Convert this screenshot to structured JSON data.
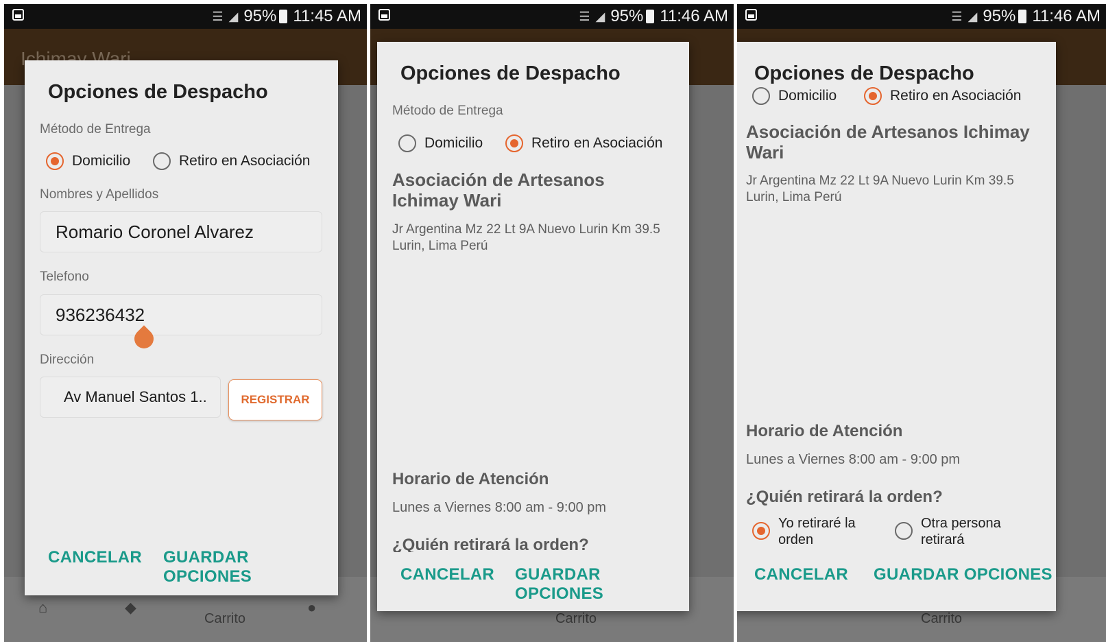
{
  "screens": [
    {
      "status": {
        "battery": "95%",
        "time": "11:45 AM"
      },
      "app_title": "Ichimay Wari",
      "dialog": {
        "title": "Opciones de Despacho",
        "method_label": "Método de Entrega",
        "options": [
          "Domicilio",
          "Retiro en Asociación"
        ],
        "selected": "Domicilio",
        "name_label": "Nombres y Apellidos",
        "name_value": "Romario Coronel Alvarez",
        "phone_label": "Telefono",
        "phone_value": "936236432",
        "address_label": "Dirección",
        "address_value": "Av Manuel Santos 1..",
        "register_button": "REGISTRAR",
        "cancel": "CANCELAR",
        "save": "GUARDAR OPCIONES"
      },
      "bottom_nav": {
        "cart_label": "Carrito"
      }
    },
    {
      "status": {
        "battery": "95%",
        "time": "11:46 AM"
      },
      "dialog": {
        "title": "Opciones de Despacho",
        "method_label": "Método de Entrega",
        "options": [
          "Domicilio",
          "Retiro en Asociación"
        ],
        "selected": "Retiro en Asociación",
        "assoc_name": "Asociación de Artesanos Ichimay Wari",
        "address": "Jr Argentina Mz 22 Lt 9A Nuevo Lurin Km 39.5 Lurin, Lima Perú",
        "hours_title": "Horario de Atención",
        "hours": "Lunes a Viernes 8:00 am - 9:00 pm",
        "who_title": "¿Quién retirará la orden?",
        "cancel": "CANCELAR",
        "save": "GUARDAR OPCIONES"
      },
      "bottom_nav": {
        "cart_label": "Carrito"
      }
    },
    {
      "status": {
        "battery": "95%",
        "time": "11:46 AM"
      },
      "dialog": {
        "title": "Opciones de Despacho",
        "options": [
          "Domicilio",
          "Retiro en Asociación"
        ],
        "selected": "Retiro en Asociación",
        "assoc_name": "Asociación de Artesanos Ichimay Wari",
        "address": "Jr Argentina Mz 22 Lt 9A Nuevo Lurin Km 39.5 Lurin, Lima Perú",
        "hours_title": "Horario de Atención",
        "hours": "Lunes a Viernes 8:00 am - 9:00 pm",
        "who_title": "¿Quién retirará la orden?",
        "who_options": [
          "Yo retiraré la orden",
          "Otra persona retirará"
        ],
        "who_selected": "Yo retiraré la orden",
        "cancel": "CANCELAR",
        "save": "GUARDAR OPCIONES"
      },
      "bottom_nav": {
        "cart_label": "Carrito"
      }
    }
  ],
  "colors": {
    "accent": "#e5652e",
    "action_text": "#1a9a8a",
    "app_bar": "#3a2714",
    "dialog_bg": "#ececec"
  },
  "icons": [
    "gallery-icon",
    "wifi-icon",
    "signal-icon",
    "battery-icon",
    "home-icon",
    "tag-icon",
    "cart-icon",
    "person-icon"
  ]
}
